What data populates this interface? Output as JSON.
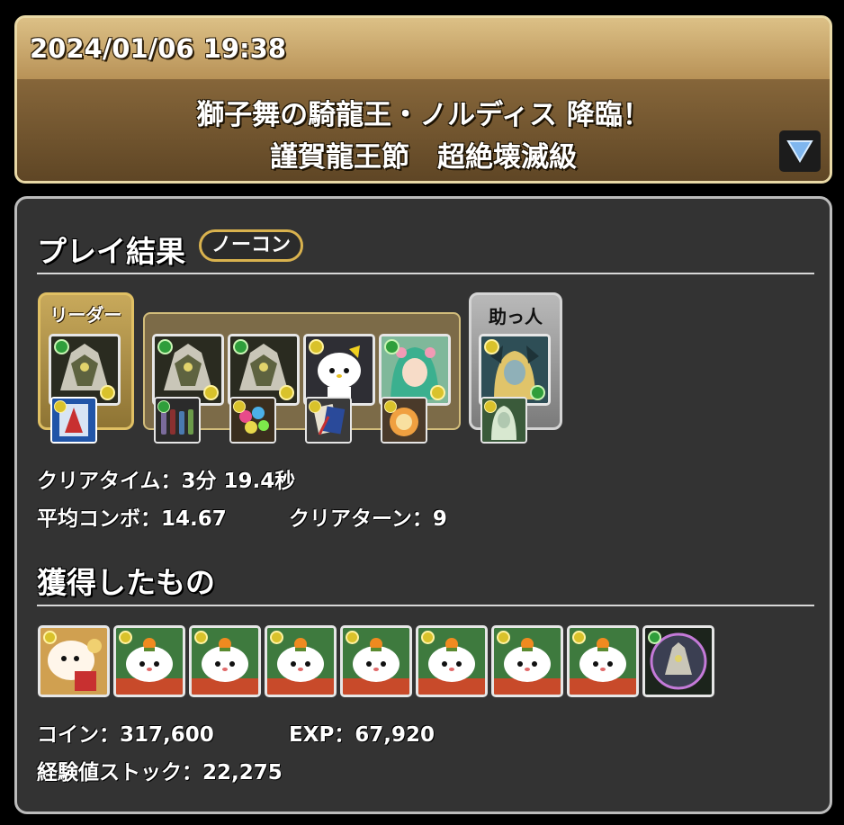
{
  "header": {
    "datetime": "2024/01/06 19:38",
    "title_line1": "獅子舞の騎龍王・ノルディス 降臨！",
    "title_line2": "謹賀龍王節　超絶壊滅級",
    "dropdown_icon": "triangle-down-icon"
  },
  "result": {
    "section_title": "プレイ結果",
    "badge": "ノーコン",
    "leader_label": "リーダー",
    "helper_label": "助っ人",
    "team": [
      {
        "slot": "leader",
        "attr": "wood",
        "sub": "light",
        "assist_attr": "light"
      },
      {
        "slot": "sub1",
        "attr": "wood",
        "sub": "light",
        "assist_attr": "wood"
      },
      {
        "slot": "sub2",
        "attr": "wood",
        "sub": "light",
        "assist_attr": "light"
      },
      {
        "slot": "sub3",
        "attr": "light",
        "sub": "light",
        "assist_attr": "light"
      },
      {
        "slot": "sub4",
        "attr": "wood",
        "sub": "light",
        "assist_attr": "light"
      },
      {
        "slot": "helper",
        "attr": "light",
        "sub": "wood",
        "assist_attr": "light"
      }
    ],
    "clear_time": "クリアタイム：3分 19.4秒",
    "avg_combo": "平均コンボ：14.67",
    "clear_turns": "クリアターン：9"
  },
  "rewards": {
    "section_title": "獲得したもの",
    "items": [
      {
        "name": "lion-dance-cat",
        "attr": "light"
      },
      {
        "name": "mochi-cat",
        "attr": "light"
      },
      {
        "name": "mochi-cat",
        "attr": "light"
      },
      {
        "name": "mochi-cat",
        "attr": "light"
      },
      {
        "name": "mochi-cat",
        "attr": "light"
      },
      {
        "name": "mochi-cat",
        "attr": "light"
      },
      {
        "name": "mochi-cat",
        "attr": "light"
      },
      {
        "name": "mochi-cat",
        "attr": "light"
      },
      {
        "name": "dragon-orb",
        "attr": "wood"
      }
    ],
    "coin": "コイン：317,600",
    "exp": "EXP：67,920",
    "exp_stock": "経験値ストック：22,275"
  },
  "colors": {
    "header_gold": "#c8a464",
    "panel_bg": "#333333",
    "wood_attr": "#2f9e3b",
    "light_attr": "#d9c22b",
    "badge_border": "#d9b24e"
  }
}
